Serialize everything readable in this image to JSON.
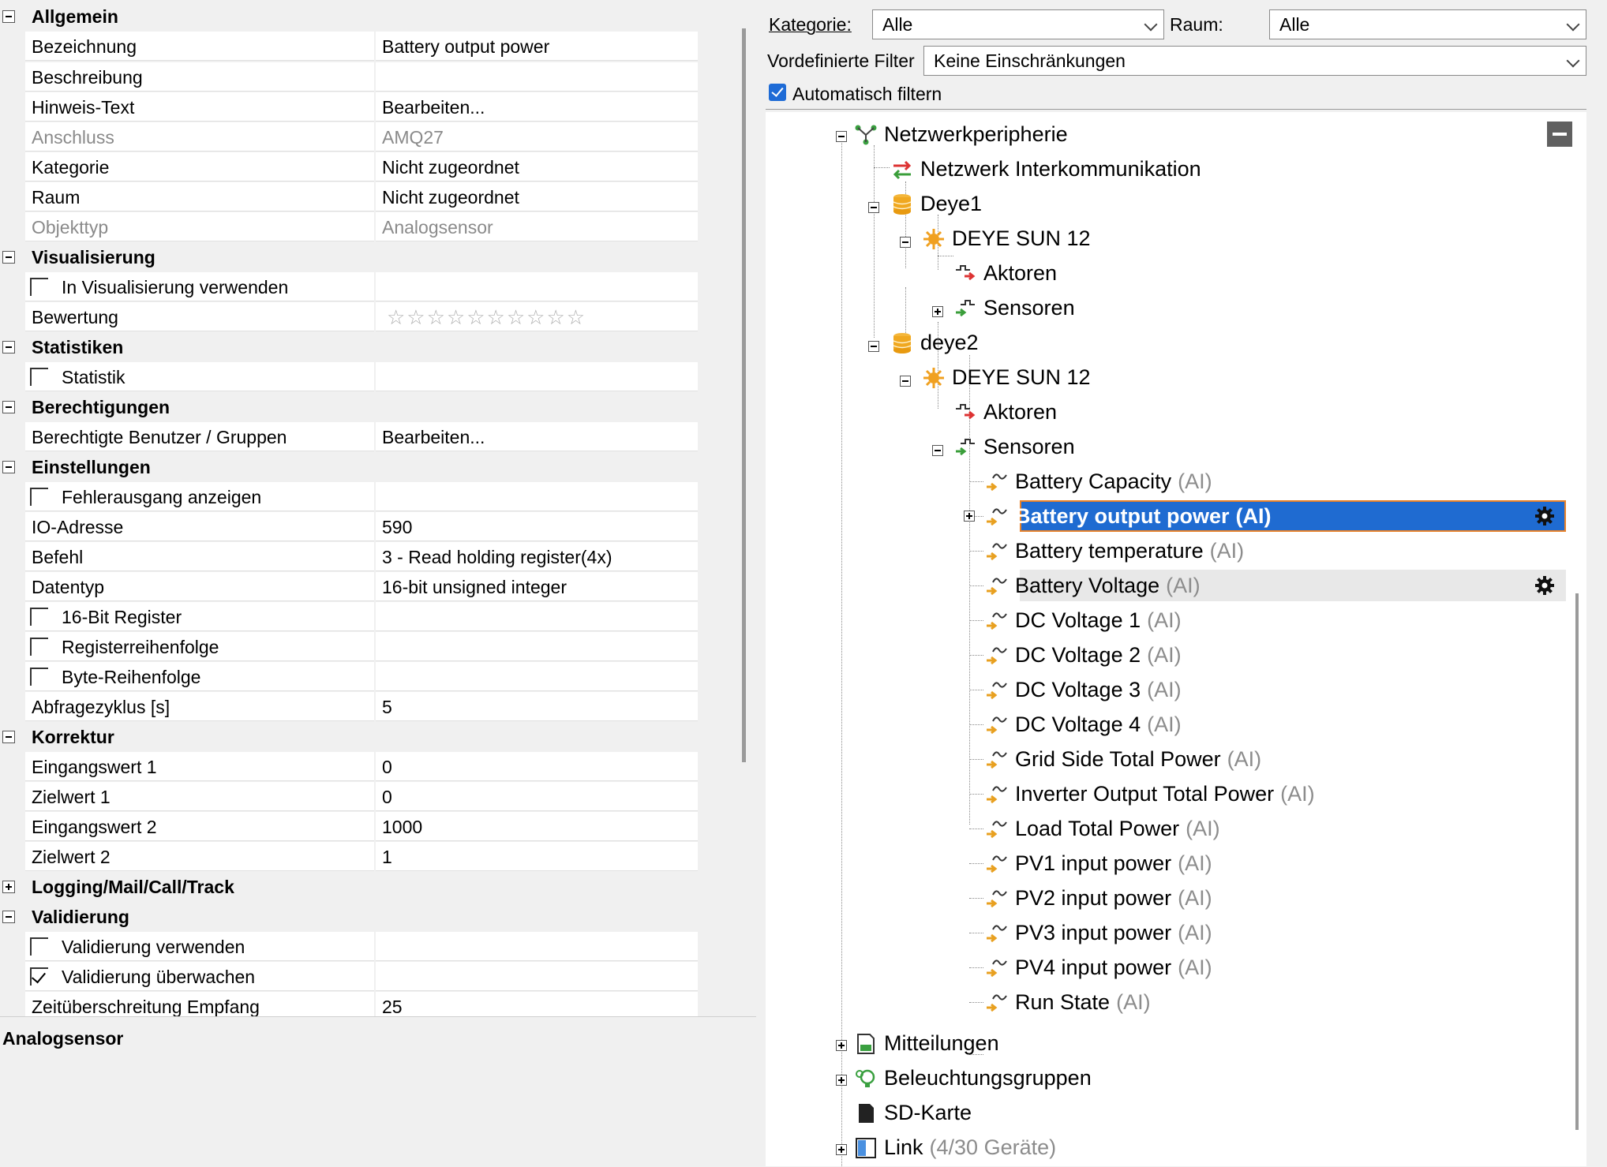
{
  "properties": {
    "sections": [
      {
        "key": "allgemein",
        "label": "Allgemein",
        "expanded": true
      },
      {
        "key": "visualisierung",
        "label": "Visualisierung",
        "expanded": true
      },
      {
        "key": "statistiken",
        "label": "Statistiken",
        "expanded": true
      },
      {
        "key": "berechtigungen",
        "label": "Berechtigungen",
        "expanded": true
      },
      {
        "key": "einstellungen",
        "label": "Einstellungen",
        "expanded": true
      },
      {
        "key": "korrektur",
        "label": "Korrektur",
        "expanded": true
      },
      {
        "key": "logging",
        "label": "Logging/Mail/Call/Track",
        "expanded": false
      },
      {
        "key": "validierung",
        "label": "Validierung",
        "expanded": true
      }
    ],
    "rows": {
      "bezeichnung": {
        "name": "Bezeichnung",
        "value": "Battery output power"
      },
      "beschreibung": {
        "name": "Beschreibung",
        "value": ""
      },
      "hinweis": {
        "name": "Hinweis-Text",
        "value": "Bearbeiten..."
      },
      "anschluss": {
        "name": "Anschluss",
        "value": "AMQ27"
      },
      "kategorie": {
        "name": "Kategorie",
        "value": "Nicht zugeordnet"
      },
      "raum": {
        "name": "Raum",
        "value": "Nicht zugeordnet"
      },
      "objekttyp": {
        "name": "Objekttyp",
        "value": "Analogsensor"
      },
      "in_vis": {
        "name": "In Visualisierung verwenden",
        "checked": false
      },
      "bewertung": {
        "name": "Bewertung",
        "stars": "☆☆☆☆☆☆☆☆☆☆",
        "rating": 0,
        "rating_max": 10
      },
      "statistik": {
        "name": "Statistik",
        "checked": false
      },
      "berechtigte": {
        "name": "Berechtigte Benutzer / Gruppen",
        "value": "Bearbeiten..."
      },
      "fehlerausgang": {
        "name": "Fehlerausgang anzeigen",
        "checked": false
      },
      "io_adresse": {
        "name": "IO-Adresse",
        "value": "590"
      },
      "befehl": {
        "name": "Befehl",
        "value": "3 - Read holding register(4x)"
      },
      "datentyp": {
        "name": "Datentyp",
        "value": "16-bit unsigned integer"
      },
      "bit16": {
        "name": "16-Bit Register",
        "checked": false
      },
      "registerreihenfolge": {
        "name": "Registerreihenfolge",
        "checked": false
      },
      "byte_reihenfolge": {
        "name": "Byte-Reihenfolge",
        "checked": false
      },
      "abfragezyklus": {
        "name": "Abfragezyklus [s]",
        "value": "5"
      },
      "eingangswert1": {
        "name": "Eingangswert 1",
        "value": "0"
      },
      "zielwert1": {
        "name": "Zielwert 1",
        "value": "0"
      },
      "eingangswert2": {
        "name": "Eingangswert 2",
        "value": "1000"
      },
      "zielwert2": {
        "name": "Zielwert 2",
        "value": "1"
      },
      "validierung_verwenden": {
        "name": "Validierung verwenden",
        "checked": false
      },
      "validierung_ueberwachen": {
        "name": "Validierung überwachen",
        "checked": true
      },
      "zeitueberschreitung": {
        "name": "Zeitüberschreitung Empfang",
        "value": "25"
      }
    },
    "description_title": "Analogsensor"
  },
  "filter": {
    "kategorie_label": "Kategorie:",
    "kategorie_value": "Alle",
    "raum_label": "Raum:",
    "raum_value": "Alle",
    "vordefiniert_label": "Vordefinierte Filter",
    "vordefiniert_value": "Keine Einschränkungen",
    "auto_label": "Automatisch filtern",
    "auto_checked": true
  },
  "tree": {
    "netzwerk": "Netzwerkperipherie",
    "interkomm": "Netzwerk Interkommunikation",
    "deye1": "Deye1",
    "deye1_sun": "DEYE SUN 12",
    "aktoren1": "Aktoren",
    "sensoren1": "Sensoren",
    "deye2": "deye2",
    "deye2_sun": "DEYE SUN 12",
    "aktoren2": "Aktoren",
    "sensoren2": "Sensoren",
    "sensors": [
      {
        "label": "Battery Capacity",
        "suffix": "(AI)"
      },
      {
        "label": "Battery output power",
        "suffix": "(AI)"
      },
      {
        "label": "Battery temperature",
        "suffix": "(AI)"
      },
      {
        "label": "Battery Voltage",
        "suffix": "(AI)"
      },
      {
        "label": "DC Voltage 1",
        "suffix": "(AI)"
      },
      {
        "label": "DC Voltage 2",
        "suffix": "(AI)"
      },
      {
        "label": "DC Voltage 3",
        "suffix": "(AI)"
      },
      {
        "label": "DC Voltage 4",
        "suffix": "(AI)"
      },
      {
        "label": "Grid Side Total Power",
        "suffix": "(AI)"
      },
      {
        "label": "Inverter Output Total Power",
        "suffix": "(AI)"
      },
      {
        "label": "Load Total Power",
        "suffix": "(AI)"
      },
      {
        "label": "PV1 input power",
        "suffix": "(AI)"
      },
      {
        "label": "PV2 input power",
        "suffix": "(AI)"
      },
      {
        "label": "PV3 input power",
        "suffix": "(AI)"
      },
      {
        "label": "PV4 input power",
        "suffix": "(AI)"
      },
      {
        "label": "Run State",
        "suffix": "(AI)"
      }
    ],
    "mitteilungen": "Mitteilungen",
    "beleuchtung": "Beleuchtungsgruppen",
    "sdkarte": "SD-Karte",
    "link": "Link",
    "link_suffix": "(4/30 Geräte)"
  },
  "colors": {
    "selection": "#1f6bd1",
    "selection_border": "#e8822a",
    "checkbox_accent": "#1e6bd6"
  },
  "icons": {
    "netzwerk": "network-icon",
    "interkomm": "exchange-arrows-icon",
    "device": "database-icon",
    "inverter": "sun-gear-icon",
    "aktoren": "actuator-icon",
    "sensoren": "sensor-icon",
    "analog": "analog-sensor-icon",
    "gear": "gear-icon",
    "mitteilungen": "message-icon",
    "beleuchtung": "light-bulb-icon",
    "sdkarte": "sd-card-icon",
    "link": "link-device-icon"
  }
}
